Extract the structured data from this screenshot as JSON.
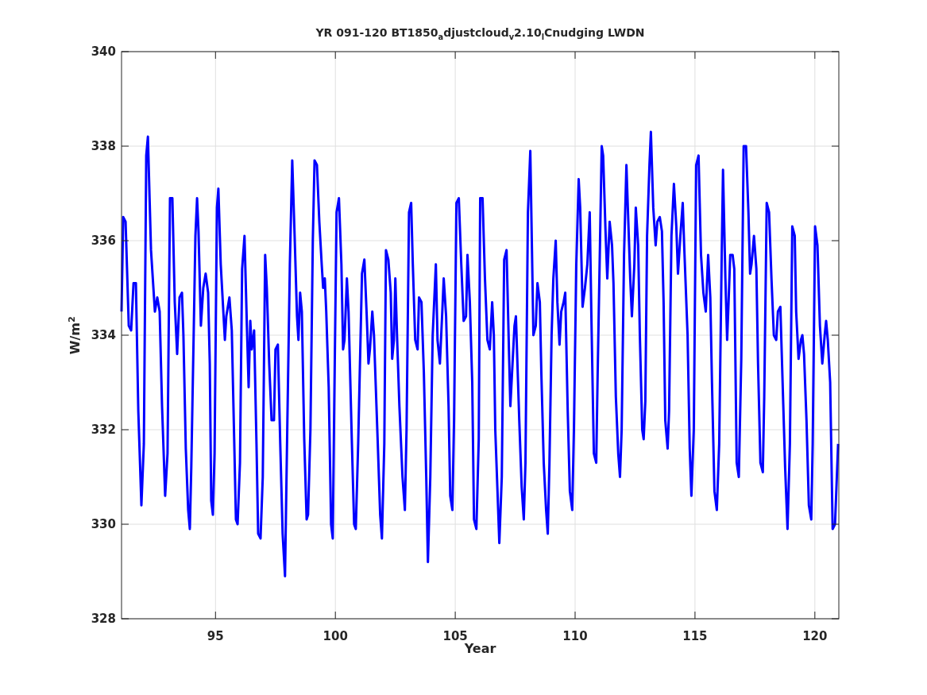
{
  "figure": {
    "chart_data": {
      "type": "line",
      "title": "YR 091-120 BT1850$_{a}$djustcloud$_{v}$2.10$_{l}$Cnudging LWDN",
      "xlabel": "Year",
      "ylabel": "W/m$^{2}$",
      "x": [
        91.08,
        91.15,
        91.25,
        91.38,
        91.48,
        91.58,
        91.68,
        91.78,
        91.91,
        92.01,
        92.11,
        92.18,
        92.31,
        92.47,
        92.57,
        92.67,
        92.77,
        92.9,
        93.0,
        93.1,
        93.2,
        93.3,
        93.4,
        93.5,
        93.6,
        93.66,
        93.76,
        93.86,
        93.93,
        93.99,
        94.09,
        94.16,
        94.23,
        94.29,
        94.39,
        94.49,
        94.59,
        94.69,
        94.76,
        94.82,
        94.89,
        94.96,
        95.06,
        95.12,
        95.22,
        95.39,
        95.45,
        95.58,
        95.68,
        95.78,
        95.85,
        95.92,
        96.02,
        96.11,
        96.21,
        96.31,
        96.38,
        96.45,
        96.51,
        96.61,
        96.71,
        96.78,
        96.88,
        96.97,
        97.07,
        97.14,
        97.24,
        97.34,
        97.44,
        97.5,
        97.6,
        97.7,
        97.8,
        97.9,
        98.0,
        98.1,
        98.2,
        98.3,
        98.4,
        98.46,
        98.53,
        98.6,
        98.7,
        98.8,
        98.86,
        98.96,
        99.06,
        99.13,
        99.23,
        99.33,
        99.43,
        99.49,
        99.56,
        99.62,
        99.72,
        99.82,
        99.89,
        99.95,
        100.05,
        100.15,
        100.25,
        100.32,
        100.38,
        100.48,
        100.55,
        100.68,
        100.78,
        100.85,
        100.95,
        101.11,
        101.21,
        101.31,
        101.38,
        101.44,
        101.54,
        101.61,
        101.77,
        101.87,
        101.94,
        102.04,
        102.11,
        102.21,
        102.31,
        102.37,
        102.44,
        102.5,
        102.57,
        102.67,
        102.8,
        102.9,
        102.97,
        103.07,
        103.16,
        103.23,
        103.33,
        103.43,
        103.49,
        103.59,
        103.69,
        103.79,
        103.86,
        103.96,
        104.06,
        104.19,
        104.26,
        104.36,
        104.46,
        104.52,
        104.62,
        104.72,
        104.79,
        104.88,
        104.95,
        105.05,
        105.15,
        105.25,
        105.35,
        105.45,
        105.51,
        105.61,
        105.71,
        105.78,
        105.88,
        105.98,
        106.04,
        106.14,
        106.24,
        106.34,
        106.44,
        106.54,
        106.61,
        106.67,
        106.77,
        106.84,
        106.94,
        107.04,
        107.14,
        107.24,
        107.3,
        107.37,
        107.47,
        107.53,
        107.67,
        107.77,
        107.86,
        107.93,
        108.03,
        108.13,
        108.26,
        108.36,
        108.43,
        108.53,
        108.59,
        108.69,
        108.79,
        108.86,
        108.93,
        109.02,
        109.09,
        109.19,
        109.26,
        109.35,
        109.42,
        109.52,
        109.59,
        109.69,
        109.78,
        109.88,
        109.95,
        110.05,
        110.15,
        110.21,
        110.31,
        110.41,
        110.51,
        110.61,
        110.68,
        110.78,
        110.88,
        110.94,
        111.04,
        111.11,
        111.17,
        111.27,
        111.34,
        111.44,
        111.54,
        111.6,
        111.7,
        111.8,
        111.87,
        111.94,
        112.04,
        112.14,
        112.2,
        112.3,
        112.37,
        112.47,
        112.53,
        112.63,
        112.7,
        112.8,
        112.86,
        112.93,
        113.0,
        113.1,
        113.16,
        113.26,
        113.36,
        113.43,
        113.53,
        113.62,
        113.69,
        113.76,
        113.86,
        113.92,
        114.02,
        114.12,
        114.22,
        114.29,
        114.39,
        114.49,
        114.55,
        114.69,
        114.78,
        114.85,
        114.95,
        115.05,
        115.15,
        115.25,
        115.35,
        115.45,
        115.55,
        115.64,
        115.71,
        115.81,
        115.91,
        116.01,
        116.11,
        116.17,
        116.27,
        116.34,
        116.4,
        116.47,
        116.57,
        116.64,
        116.74,
        116.83,
        116.93,
        117.03,
        117.13,
        117.23,
        117.3,
        117.36,
        117.46,
        117.56,
        117.63,
        117.73,
        117.83,
        117.89,
        117.99,
        118.09,
        118.19,
        118.29,
        118.39,
        118.46,
        118.56,
        118.66,
        118.76,
        118.86,
        118.96,
        119.06,
        119.16,
        119.22,
        119.32,
        119.42,
        119.48,
        119.55,
        119.65,
        119.75,
        119.85,
        119.91,
        120.01,
        120.11,
        120.21,
        120.31,
        120.41,
        120.47,
        120.54,
        120.64,
        120.74,
        120.84,
        120.97
      ],
      "series": [
        {
          "color": "#0000ff",
          "values": [
            334.5,
            336.5,
            336.4,
            334.2,
            334.1,
            335.1,
            335.1,
            332.4,
            330.4,
            331.7,
            337.8,
            338.2,
            335.8,
            334.5,
            334.8,
            334.5,
            332.5,
            330.6,
            331.5,
            336.9,
            336.9,
            334.7,
            333.6,
            334.8,
            334.9,
            334.0,
            331.6,
            330.3,
            329.9,
            331.2,
            334.0,
            336.1,
            336.9,
            336.2,
            334.2,
            335.0,
            335.3,
            334.9,
            333.4,
            330.5,
            330.2,
            331.5,
            336.7,
            337.1,
            335.5,
            333.9,
            334.4,
            334.8,
            334.1,
            331.8,
            330.1,
            330.0,
            331.3,
            335.4,
            336.1,
            334.2,
            332.9,
            334.3,
            333.7,
            334.1,
            331.7,
            329.8,
            329.7,
            331.0,
            335.7,
            335.0,
            333.4,
            332.2,
            332.2,
            333.7,
            333.8,
            331.7,
            329.8,
            328.9,
            332.2,
            335.5,
            337.7,
            336.1,
            334.4,
            333.9,
            334.9,
            334.5,
            331.8,
            330.1,
            330.2,
            332.0,
            336.0,
            337.7,
            337.6,
            336.4,
            335.5,
            335.0,
            335.2,
            334.5,
            332.9,
            330.0,
            329.7,
            332.4,
            336.6,
            336.9,
            335.5,
            333.7,
            333.9,
            335.2,
            334.5,
            331.9,
            330.0,
            329.9,
            331.7,
            335.3,
            335.6,
            334.4,
            333.4,
            333.7,
            334.5,
            334.0,
            331.7,
            330.2,
            329.7,
            331.7,
            335.8,
            335.6,
            334.9,
            333.5,
            333.9,
            335.2,
            334.0,
            332.5,
            331.0,
            330.3,
            332.0,
            336.6,
            336.8,
            335.5,
            333.9,
            333.7,
            334.8,
            334.7,
            333.2,
            331.0,
            329.2,
            331.0,
            334.0,
            335.5,
            333.9,
            333.4,
            334.5,
            335.2,
            334.4,
            332.5,
            330.6,
            330.3,
            332.2,
            336.8,
            336.9,
            335.5,
            334.3,
            334.4,
            335.7,
            334.7,
            333.0,
            330.1,
            329.9,
            331.8,
            336.9,
            336.9,
            335.2,
            333.9,
            333.7,
            334.7,
            334.0,
            332.0,
            330.6,
            329.6,
            331.0,
            335.6,
            335.8,
            333.7,
            332.5,
            333.2,
            334.2,
            334.4,
            332.2,
            330.8,
            330.1,
            331.3,
            336.6,
            337.9,
            334.0,
            334.2,
            335.1,
            334.7,
            333.2,
            331.3,
            330.3,
            329.8,
            331.3,
            334.0,
            335.2,
            336.0,
            334.7,
            333.8,
            334.5,
            334.7,
            334.9,
            332.4,
            330.7,
            330.3,
            332.0,
            335.5,
            337.3,
            336.7,
            334.6,
            335.0,
            335.5,
            336.6,
            334.4,
            331.5,
            331.3,
            333.2,
            336.0,
            338.0,
            337.8,
            336.2,
            335.2,
            336.4,
            335.9,
            335.1,
            332.7,
            331.5,
            331.0,
            332.0,
            335.7,
            337.6,
            336.7,
            335.2,
            334.4,
            335.5,
            336.7,
            335.9,
            334.0,
            332.0,
            331.8,
            332.6,
            336.1,
            337.6,
            338.3,
            336.7,
            335.9,
            336.4,
            336.5,
            336.2,
            334.7,
            332.2,
            331.6,
            332.4,
            336.1,
            337.2,
            336.3,
            335.3,
            336.1,
            336.8,
            335.9,
            334.0,
            331.6,
            330.6,
            332.0,
            337.6,
            337.8,
            335.7,
            334.9,
            334.5,
            335.7,
            334.8,
            333.0,
            330.7,
            330.3,
            331.7,
            335.5,
            337.5,
            335.2,
            333.9,
            334.7,
            335.7,
            335.7,
            335.4,
            331.3,
            331.0,
            333.5,
            338.0,
            338.0,
            336.6,
            335.3,
            335.5,
            336.1,
            335.4,
            333.4,
            331.3,
            331.1,
            332.7,
            336.8,
            336.6,
            335.2,
            334.0,
            333.9,
            334.5,
            334.6,
            332.9,
            331.2,
            329.9,
            331.7,
            336.3,
            336.1,
            334.5,
            333.5,
            333.9,
            334.0,
            333.6,
            332.2,
            330.4,
            330.1,
            331.7,
            336.3,
            335.9,
            334.2,
            333.4,
            334.0,
            334.3,
            333.9,
            333.0,
            329.9,
            330.0,
            331.7
          ]
        }
      ],
      "xlim": [
        91.08,
        121
      ],
      "ylim": [
        328,
        340
      ],
      "grid": true,
      "xticks": [
        95,
        100,
        105,
        110,
        115,
        120
      ],
      "yticks": [
        328,
        330,
        332,
        334,
        336,
        338,
        340
      ]
    }
  }
}
